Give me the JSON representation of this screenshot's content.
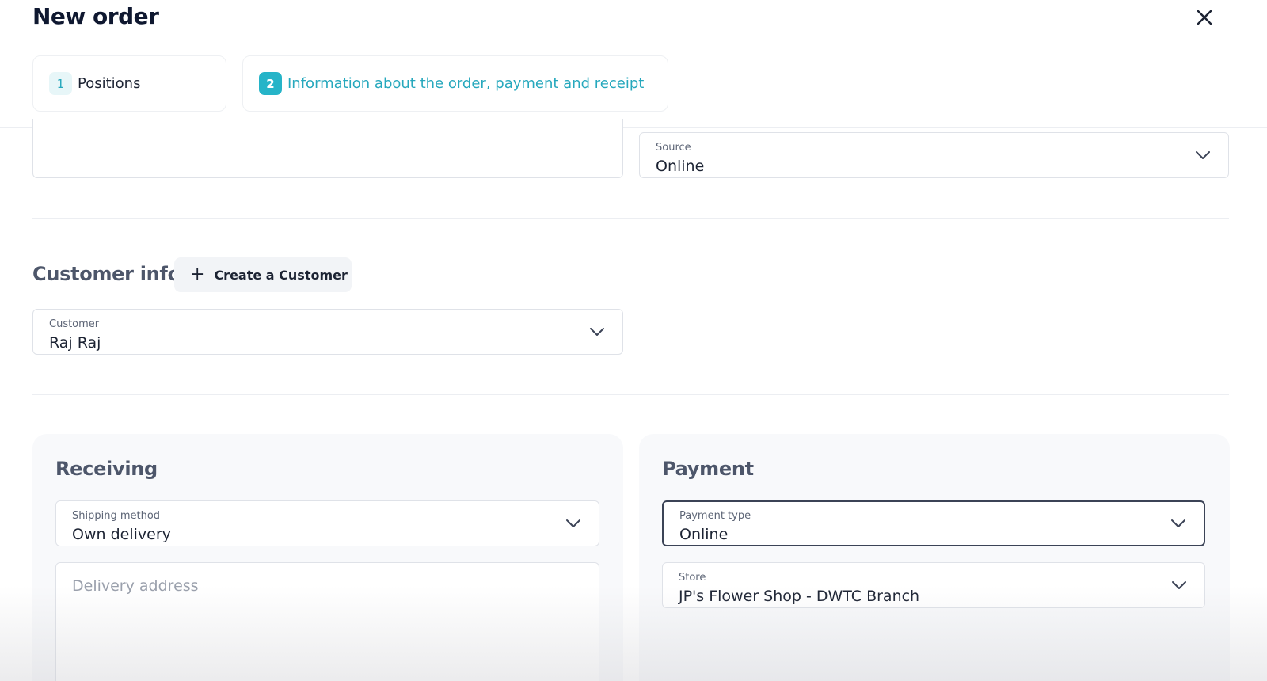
{
  "header": {
    "title": "New order",
    "close_icon": "close-icon"
  },
  "steps": [
    {
      "number": "1",
      "label": "Positions",
      "active": false
    },
    {
      "number": "2",
      "label": "Information about the order, payment and receipt",
      "active": true
    }
  ],
  "order": {
    "notes_value": "",
    "source": {
      "label": "Source",
      "value": "Online"
    }
  },
  "customer_info": {
    "title": "Customer info",
    "create_button": "Create a Customer",
    "customer": {
      "label": "Customer",
      "value": "Raj Raj"
    }
  },
  "receiving": {
    "title": "Receiving",
    "shipping_method": {
      "label": "Shipping method",
      "value": "Own delivery"
    },
    "delivery_address_placeholder": "Delivery address"
  },
  "payment": {
    "title": "Payment",
    "payment_type": {
      "label": "Payment type",
      "value": "Online"
    },
    "store": {
      "label": "Store",
      "value": "JP's Flower Shop - DWTC Branch"
    }
  },
  "colors": {
    "accent": "#26b4c8",
    "text": "#1c2333",
    "muted": "#4d566a"
  }
}
